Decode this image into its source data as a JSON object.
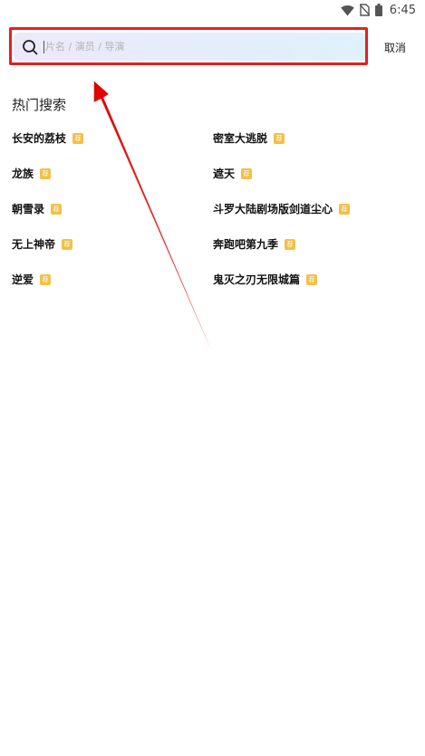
{
  "status_bar": {
    "time": "6:45",
    "icons": [
      "wifi-icon",
      "no-sim-icon",
      "battery-icon"
    ]
  },
  "search": {
    "placeholder": "片名 / 演员 / 导演",
    "value": "",
    "cancel_label": "取消",
    "gradient_colors": [
      "#ece9fb",
      "#dff2fb"
    ],
    "highlight_color": "#e32020"
  },
  "hot_search": {
    "title": "热门搜索",
    "badge_label": "荐",
    "badge_color": "#f2c04a",
    "left_column": [
      "长安的荔枝",
      "龙族",
      "朝雪录",
      "无上神帝",
      "逆爱"
    ],
    "right_column": [
      "密室大逃脱",
      "遮天",
      "斗罗大陆剧场版剑道尘心",
      "奔跑吧第九季",
      "鬼灭之刃无限城篇"
    ]
  }
}
